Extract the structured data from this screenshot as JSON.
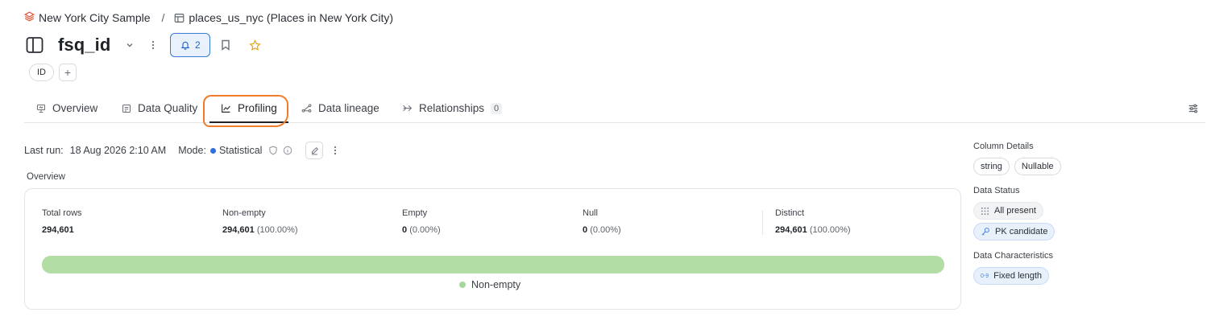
{
  "breadcrumb": {
    "workspace": "New York City Sample",
    "separator": "/",
    "table": "places_us_nyc (Places in New York City)"
  },
  "header": {
    "title": "fsq_id",
    "alert_count": "2"
  },
  "tags": [
    "ID"
  ],
  "tabs": [
    {
      "label": "Overview",
      "icon": "presentation-icon"
    },
    {
      "label": "Data Quality",
      "icon": "checklist-icon"
    },
    {
      "label": "Profiling",
      "icon": "chart-line-icon",
      "active": true
    },
    {
      "label": "Data lineage",
      "icon": "lineage-icon"
    },
    {
      "label": "Relationships",
      "icon": "relationships-icon",
      "count": "0"
    }
  ],
  "run": {
    "last_run_label": "Last run:",
    "last_run_value": "18 Aug 2026 2:10 AM",
    "mode_label": "Mode:",
    "mode_value": "Statistical",
    "mode_color": "#2f6fe0"
  },
  "overview": {
    "section_label": "Overview",
    "stats": {
      "total_rows": {
        "label": "Total rows",
        "value": "294,601"
      },
      "non_empty": {
        "label": "Non-empty",
        "value": "294,601",
        "pct": "(100.00%)"
      },
      "empty": {
        "label": "Empty",
        "value": "0",
        "pct": "(0.00%)"
      },
      "null": {
        "label": "Null",
        "value": "0",
        "pct": "(0.00%)"
      },
      "distinct": {
        "label": "Distinct",
        "value": "294,601",
        "pct": "(100.00%)"
      }
    },
    "bar_non_empty_fraction": 1.0,
    "bar_color": "#b2dea6",
    "legend_label": "Non-empty"
  },
  "side": {
    "column_details": {
      "heading": "Column Details",
      "chips": [
        "string",
        "Nullable"
      ]
    },
    "data_status": {
      "heading": "Data Status",
      "all_present": "All present",
      "pk_candidate": "PK candidate"
    },
    "data_characteristics": {
      "heading": "Data Characteristics",
      "fixed_length": "Fixed length",
      "fixed_length_icon_text": "0-9"
    }
  },
  "accent_colors": {
    "highlight_circle": "#f07c2a",
    "primary": "#3a7bd5",
    "star": "#e8a317"
  }
}
